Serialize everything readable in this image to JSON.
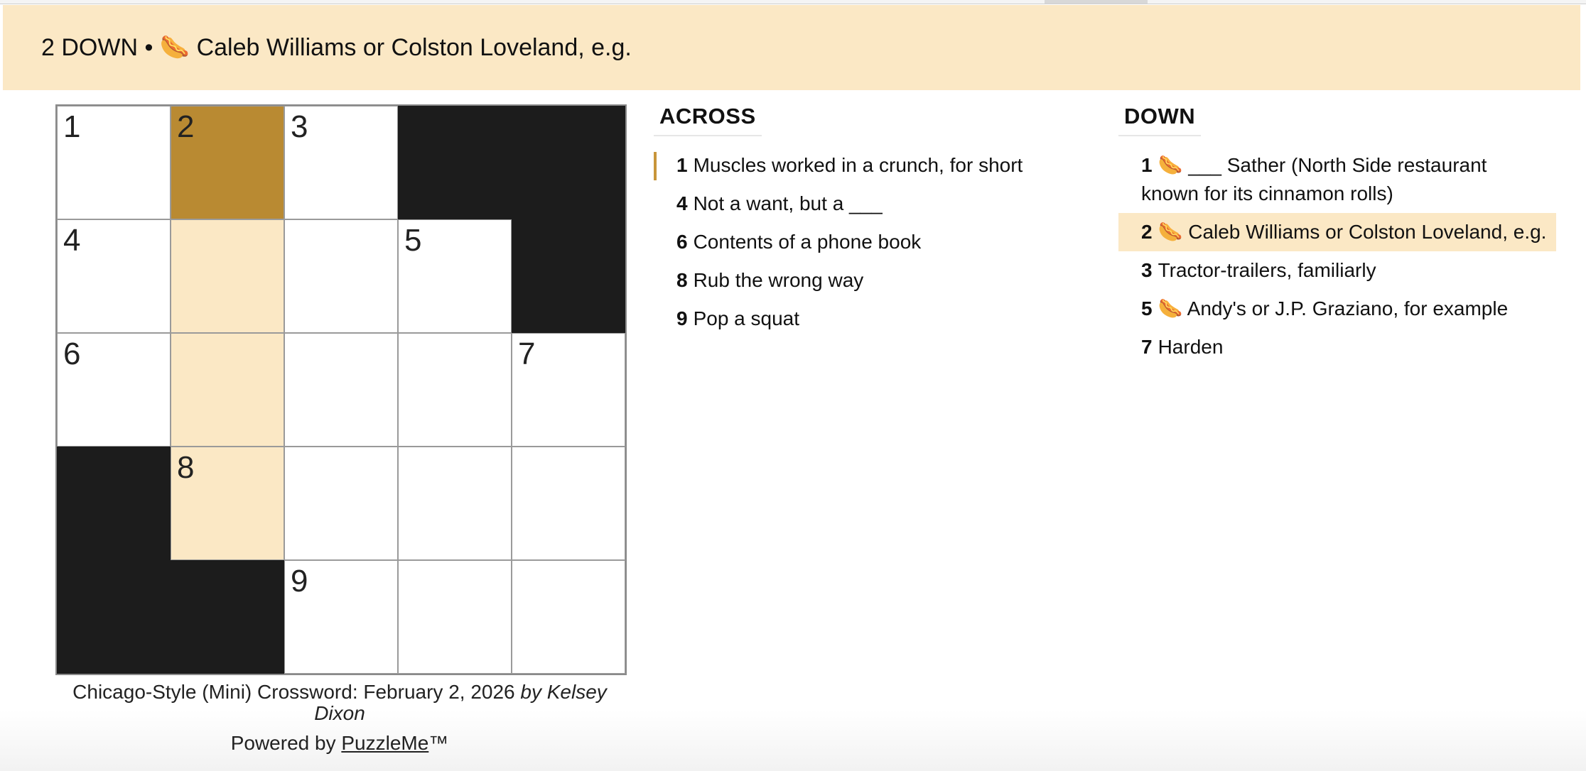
{
  "active_clue": {
    "text": "2 DOWN • 🌭 Caleb Williams or Colston Loveland, e.g."
  },
  "grid": {
    "cells": [
      {
        "r": 0,
        "c": 0,
        "num": "1",
        "state": "open"
      },
      {
        "r": 0,
        "c": 1,
        "num": "2",
        "state": "active"
      },
      {
        "r": 0,
        "c": 2,
        "num": "3",
        "state": "open"
      },
      {
        "r": 0,
        "c": 3,
        "num": "",
        "state": "black"
      },
      {
        "r": 0,
        "c": 4,
        "num": "",
        "state": "black"
      },
      {
        "r": 1,
        "c": 0,
        "num": "4",
        "state": "open"
      },
      {
        "r": 1,
        "c": 1,
        "num": "",
        "state": "word"
      },
      {
        "r": 1,
        "c": 2,
        "num": "",
        "state": "open"
      },
      {
        "r": 1,
        "c": 3,
        "num": "5",
        "state": "open"
      },
      {
        "r": 1,
        "c": 4,
        "num": "",
        "state": "black"
      },
      {
        "r": 2,
        "c": 0,
        "num": "6",
        "state": "open"
      },
      {
        "r": 2,
        "c": 1,
        "num": "",
        "state": "word"
      },
      {
        "r": 2,
        "c": 2,
        "num": "",
        "state": "open"
      },
      {
        "r": 2,
        "c": 3,
        "num": "",
        "state": "open"
      },
      {
        "r": 2,
        "c": 4,
        "num": "7",
        "state": "open"
      },
      {
        "r": 3,
        "c": 0,
        "num": "",
        "state": "black"
      },
      {
        "r": 3,
        "c": 1,
        "num": "8",
        "state": "word"
      },
      {
        "r": 3,
        "c": 2,
        "num": "",
        "state": "open"
      },
      {
        "r": 3,
        "c": 3,
        "num": "",
        "state": "open"
      },
      {
        "r": 3,
        "c": 4,
        "num": "",
        "state": "open"
      },
      {
        "r": 4,
        "c": 0,
        "num": "",
        "state": "black"
      },
      {
        "r": 4,
        "c": 1,
        "num": "",
        "state": "black"
      },
      {
        "r": 4,
        "c": 2,
        "num": "9",
        "state": "open"
      },
      {
        "r": 4,
        "c": 3,
        "num": "",
        "state": "open"
      },
      {
        "r": 4,
        "c": 4,
        "num": "",
        "state": "open"
      }
    ]
  },
  "footer": {
    "title": "Chicago-Style (Mini) Crossword: February 2, 2026",
    "by": "by Kelsey Dixon",
    "powered_prefix": "Powered by",
    "powered_link": "PuzzleMe",
    "powered_suffix": "™"
  },
  "across": {
    "header": "ACROSS",
    "clues": [
      {
        "num": "1",
        "text": "Muscles worked in a crunch, for short"
      },
      {
        "num": "4",
        "text": "Not a want, but a ___"
      },
      {
        "num": "6",
        "text": "Contents of a phone book"
      },
      {
        "num": "8",
        "text": "Rub the wrong way"
      },
      {
        "num": "9",
        "text": "Pop a squat"
      }
    ]
  },
  "down": {
    "header": "DOWN",
    "clues": [
      {
        "num": "1",
        "text": "🌭 ___ Sather (North Side restaurant known for its cinnamon rolls)"
      },
      {
        "num": "2",
        "text": "🌭 Caleb Williams or Colston Loveland, e.g."
      },
      {
        "num": "3",
        "text": "Tractor-trailers, familiarly"
      },
      {
        "num": "5",
        "text": "🌭 Andy's or J.P. Graziano, for example"
      },
      {
        "num": "7",
        "text": "Harden"
      }
    ]
  }
}
